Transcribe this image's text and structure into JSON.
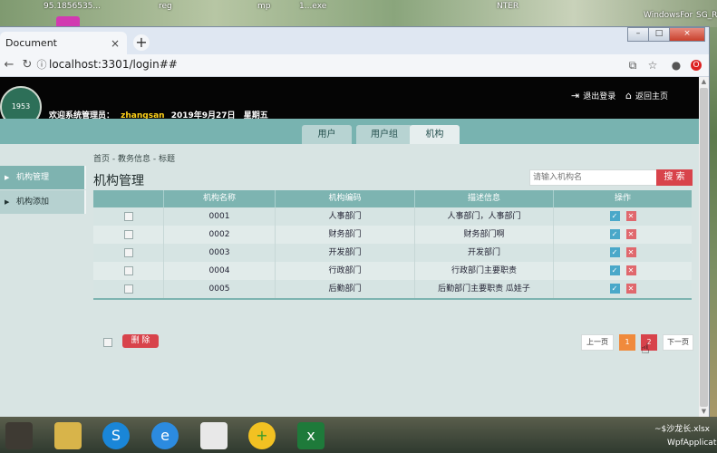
{
  "desktop": {
    "labels": [
      "95.1856535...",
      "reg",
      "mp",
      "1...exe",
      "NTER",
      "WindowsFor",
      "SG_R"
    ]
  },
  "browser": {
    "tab_title": "Document",
    "tab_close": "×",
    "new_tab": "+",
    "window_controls": {
      "minimize": "–",
      "maximize": "□",
      "close": "×"
    },
    "back": "←",
    "forward": "→",
    "reload": "↻",
    "info_icon": "ⓘ",
    "address": "localhost:3301/login##",
    "ext_icons": {
      "translate": "⧉",
      "star": "☆",
      "account": "●",
      "opera": "O"
    }
  },
  "header": {
    "logo_text": "1953",
    "welcome_prefix": "欢迎系统管理员：",
    "username": "zhangsan",
    "date": "2019年9月27日",
    "weekday": "星期五",
    "logout_label": "退出登录",
    "home_label": "返回主页",
    "logout_icon": "⇥",
    "home_icon": "⌂"
  },
  "nav": {
    "tabs": [
      {
        "label": "用户",
        "active": false
      },
      {
        "label": "用户组",
        "active": false
      },
      {
        "label": "机构",
        "active": true
      }
    ]
  },
  "breadcrumb": "首页 - 教务信息 - 标题",
  "sidebar": {
    "items": [
      {
        "label": "机构管理",
        "active": true
      },
      {
        "label": "机构添加",
        "active": false
      }
    ],
    "arrow": "▶"
  },
  "main": {
    "title": "机构管理",
    "search_placeholder": "请输入机构名",
    "search_button": "搜 索",
    "columns": [
      "",
      "机构名称",
      "机构编码",
      "描述信息",
      "操作"
    ],
    "rows": [
      {
        "code": "0001",
        "name": "人事部门",
        "desc": "人事部门，人事部门"
      },
      {
        "code": "0002",
        "name": "财务部门",
        "desc": "财务部门啊"
      },
      {
        "code": "0003",
        "name": "开发部门",
        "desc": "开发部门"
      },
      {
        "code": "0004",
        "name": "行政部门",
        "desc": "行政部门主要职责"
      },
      {
        "code": "0005",
        "name": "后勤部门",
        "desc": "后勤部门主要职责 瓜娃子"
      }
    ],
    "ok_glyph": "✓",
    "del_glyph": "✕",
    "bulk_delete": "删 除",
    "pager": {
      "prev": "上一页",
      "pages": [
        "1",
        "2"
      ],
      "next": "下一页"
    }
  },
  "taskbar": {
    "file_label": "~$沙龙长.xlsx",
    "app_label": "WpfApplicatio"
  },
  "colors": {
    "header_bg": "#050505",
    "nav_bg": "#78b3b0",
    "accent_red": "#d8434b",
    "page_current": "#f08a3c",
    "username": "#ffd21a"
  }
}
